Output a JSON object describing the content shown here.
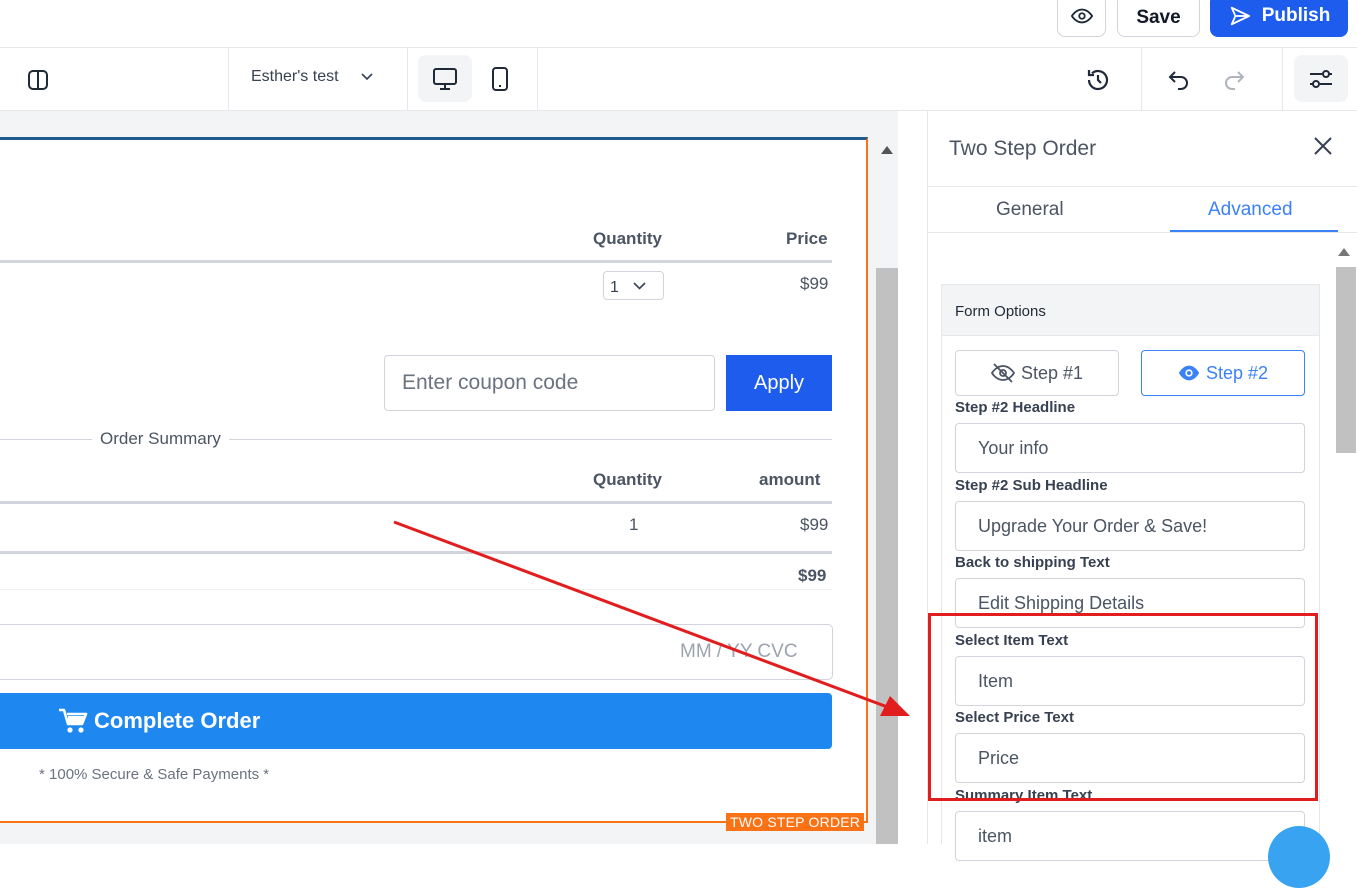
{
  "header": {
    "save_label": "Save",
    "publish_label": "Publish"
  },
  "toolbar": {
    "page_name": "Esther's test"
  },
  "canvas": {
    "block_tag": "TWO STEP ORDER",
    "items_table": {
      "col_quantity": "Quantity",
      "col_price": "Price",
      "quantity_value": "1",
      "price_value": "$99"
    },
    "coupon": {
      "placeholder": "Enter coupon code",
      "apply_label": "Apply"
    },
    "summary": {
      "label": "Order Summary",
      "col_quantity": "Quantity",
      "col_amount": "amount",
      "row_quantity": "1",
      "row_amount": "$99",
      "total": "$99"
    },
    "card_placeholder": "MM / YY  CVC",
    "complete_label": "Complete Order",
    "secure_text": "* 100% Secure & Safe Payments *"
  },
  "panel": {
    "title": "Two Step Order",
    "tabs": [
      {
        "label": "General",
        "active": false
      },
      {
        "label": "Advanced",
        "active": true
      }
    ],
    "section_title": "Form Options",
    "step1_label": "Step #1",
    "step2_label": "Step #2",
    "fields": [
      {
        "label": "Step #2 Headline",
        "value": "Your info"
      },
      {
        "label": "Step #2 Sub Headline",
        "value": "Upgrade Your Order & Save!"
      },
      {
        "label": "Back to shipping Text",
        "value": "Edit Shipping Details"
      },
      {
        "label": "Select Item Text",
        "value": "Item"
      },
      {
        "label": "Select Price Text",
        "value": "Price"
      },
      {
        "label": "Summary Item Text",
        "value": "item"
      }
    ]
  },
  "colors": {
    "primary": "#1d5ced",
    "accent_blue": "#3b82f6",
    "block_outline": "#f97316",
    "annotation_red": "#e11d1d"
  }
}
